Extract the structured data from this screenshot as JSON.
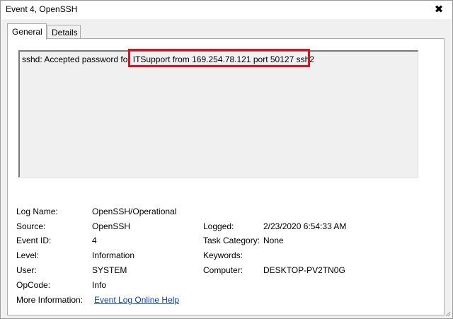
{
  "window": {
    "title": "Event 4, OpenSSH",
    "close_glyph": "✖"
  },
  "tabs": [
    {
      "label": "General",
      "active": true
    },
    {
      "label": "Details",
      "active": false
    }
  ],
  "message": {
    "prefix": "sshd: Accepted password for ",
    "highlighted": "ITSupport from 169.254.78.121 port 50127 ssh2",
    "highlight_color": "#e0101e"
  },
  "fields": {
    "log_name": {
      "label": "Log Name:",
      "value": "OpenSSH/Operational"
    },
    "source": {
      "label": "Source:",
      "value": "OpenSSH"
    },
    "logged": {
      "label": "Logged:",
      "value": "2/23/2020 6:54:33 AM"
    },
    "event_id": {
      "label": "Event ID:",
      "value": "4"
    },
    "task_category": {
      "label": "Task Category:",
      "value": "None"
    },
    "level": {
      "label": "Level:",
      "value": "Information"
    },
    "keywords": {
      "label": "Keywords:",
      "value": ""
    },
    "user": {
      "label": "User:",
      "value": "SYSTEM"
    },
    "computer": {
      "label": "Computer:",
      "value": "DESKTOP-PV2TN0G"
    },
    "opcode": {
      "label": "OpCode:",
      "value": "Info"
    },
    "more_info": {
      "label": "More Information:",
      "link": "Event Log Online Help"
    }
  },
  "colors": {
    "link": "#0a43d8",
    "dialog_bg": "#f0f0f0",
    "highlight": "#e0101e"
  }
}
